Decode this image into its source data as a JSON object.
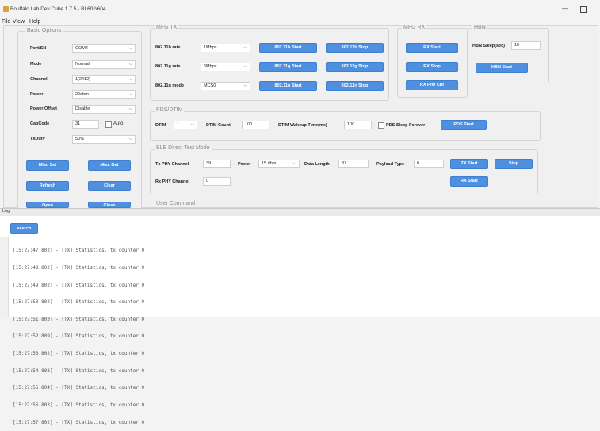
{
  "window": {
    "title": "Bouffalo Lab Dev Cube 1.7.5 - BL602/604",
    "minimize": "—"
  },
  "menu": [
    "File",
    "View",
    "Help"
  ],
  "basic_options": {
    "title": "Basic Options",
    "rows": [
      {
        "label": "Port/SN",
        "value": "COM4"
      },
      {
        "label": "Mode",
        "value": "Normal"
      },
      {
        "label": "Channel",
        "value": "1(2412)"
      },
      {
        "label": "Power",
        "value": "20dbm"
      },
      {
        "label": "Power Offset",
        "value": "Disable"
      }
    ],
    "capcode_label": "CapCode",
    "capcode_value": "31",
    "auto_label": "Auto",
    "txduty_label": "TxDuty",
    "txduty_value": "50%",
    "buttons": {
      "misc_set": "Misc Set",
      "misc_get": "Misc Get",
      "refresh": "Refresh",
      "clear": "Clear",
      "open": "Open",
      "close": "Close"
    }
  },
  "mfg_tx": {
    "title": "MFG TX",
    "rows": [
      {
        "label": "802.11b rate",
        "value": "1Mbps",
        "start": "802.11b Start",
        "stop": "802.11b Stop"
      },
      {
        "label": "802.11g rate",
        "value": "6Mbps",
        "start": "802.11g Start",
        "stop": "802.11g Stop"
      },
      {
        "label": "802.11n mode",
        "value": "MCS0",
        "start": "802.11n Start",
        "stop": "802.11n Stop"
      }
    ]
  },
  "mfg_rx": {
    "title": "MFG RX",
    "rx_start": "RX Start",
    "rx_stop": "RX Stop",
    "rx_frm_cnt": "RX Frm Cnt"
  },
  "hbn": {
    "title": "HBN",
    "sleep_label": "HBN Sleep(sec)",
    "sleep_value": "10",
    "start": "HBN Start"
  },
  "pds": {
    "title": "PDS/DTIM",
    "dtim_label": "DTIM",
    "dtim_value": "1",
    "dtim_count_label": "DTIM Count",
    "dtim_count_value": "100",
    "wakeup_label": "DTIM Wakeup Time(ms)",
    "wakeup_value": "100",
    "sleep_forever_label": "PDS Sleep Forever",
    "start": "PDS Start"
  },
  "ble": {
    "title": "BLE Direct Test Mode",
    "tx_channel_label": "Tx PHY Channel",
    "tx_channel_value": "39",
    "power_label": "Power",
    "power_value": "15 dbm",
    "data_length_label": "Data Length",
    "data_length_value": "37",
    "payload_label": "Payload Type",
    "payload_value": "0",
    "tx_start": "TX Start",
    "stop": "Stop",
    "rx_channel_label": "Rx PHY Channel",
    "rx_channel_value": "0",
    "rx_start": "RX Start"
  },
  "user_command": {
    "title": "User Command"
  },
  "log": {
    "title": "Log",
    "search": "search",
    "lines": [
      "[15:27:47.802] - [TX] Statistics, tx counter 0",
      "[15:27:48.802] - [TX] Statistics, tx counter 0",
      "[15:27:49.802] - [TX] Statistics, tx counter 0",
      "[15:27:50.802] - [TX] Statistics, tx counter 0",
      "[15:27:51.803] - [TX] Statistics, tx counter 0",
      "[15:27:52.809] - [TX] Statistics, tx counter 0",
      "[15:27:53.802] - [TX] Statistics, tx counter 0",
      "[15:27:54.803] - [TX] Statistics, tx counter 0",
      "[15:27:55.804] - [TX] Statistics, tx counter 0",
      "[15:27:56.803] - [TX] Statistics, tx counter 0",
      "[15:27:57.802] - [TX] Statistics, tx counter 0"
    ]
  }
}
